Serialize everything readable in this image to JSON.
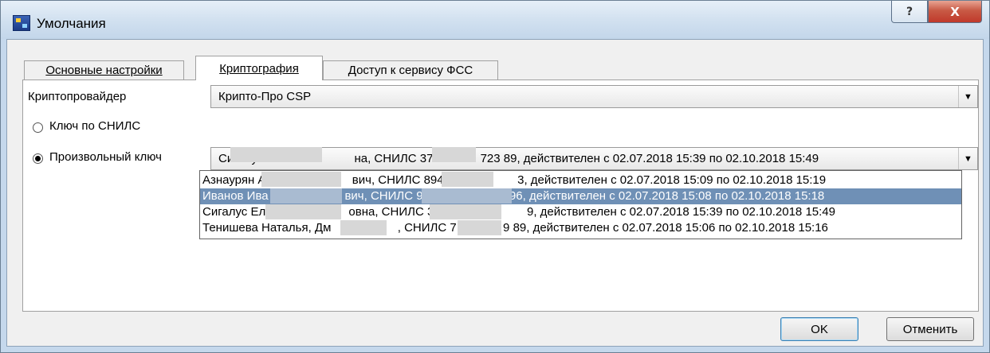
{
  "window": {
    "title": "Умолчания",
    "help_glyph": "?",
    "close_glyph": "X"
  },
  "tabs": [
    {
      "label": "Основные настройки",
      "active": false
    },
    {
      "label": "Криптография",
      "active": true
    },
    {
      "label": "Доступ к сервису ФСС",
      "active": false
    }
  ],
  "form": {
    "provider_label": "Криптопровайдер",
    "provider_value": "Крипто-Про CSP",
    "radio_snils_label": "Ключ по СНИЛС",
    "radio_custom_label": "Произвольный ключ",
    "key_value": "Сигалус Е                        на, СНИЛС 373-           723 89, действителен с 02.07.2018 15:39 по 02.10.2018 15:49"
  },
  "dropdown": {
    "items": [
      "Азнаурян А                          вич, СНИЛС 894-565               3, действителен с 02.07.2018 15:09 по 02.10.2018 15:19",
      "Иванов Ива                       вич, СНИЛС 9                          96, действителен с 02.07.2018 15:08 по 02.10.2018 15:18",
      "Сигалус Ел                         овна, СНИЛС 373                        9, действителен с 02.07.2018 15:39 по 02.10.2018 15:49",
      "Тенишева Наталья, Дм                    , СНИЛС 7              9 89, действителен с 02.07.2018 15:06 по 02.10.2018 15:16"
    ],
    "selected_index": 1
  },
  "buttons": {
    "ok": "OK",
    "cancel": "Отменить"
  },
  "icons": {
    "combo_arrow": "▼"
  }
}
